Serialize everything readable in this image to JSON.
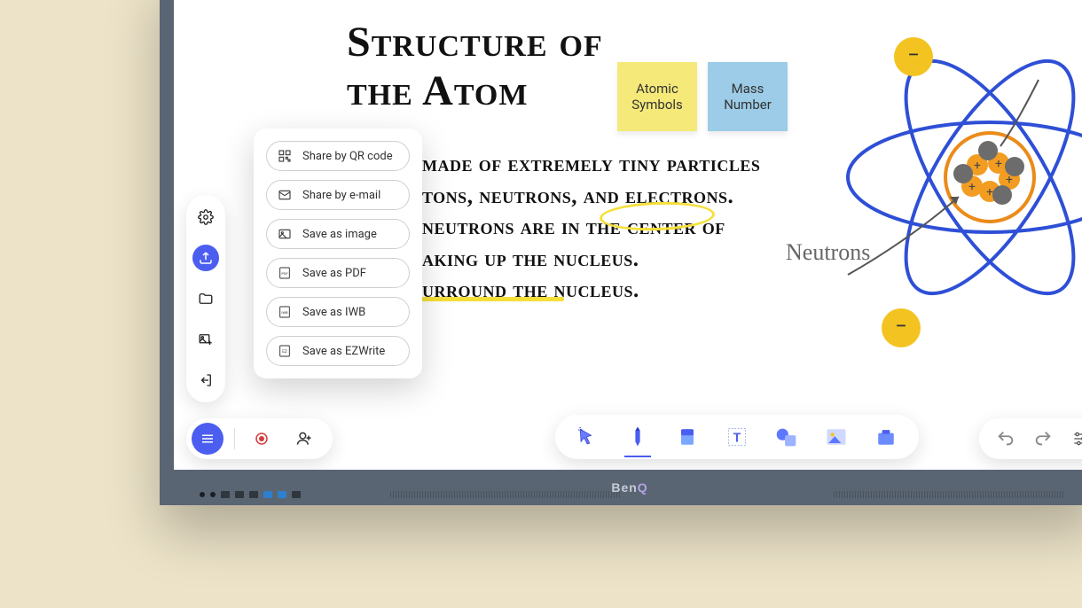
{
  "brand": "BenQ",
  "canvas": {
    "title": "Structure of\nthe Atom",
    "body": "made of extremely tiny particles\ntons, neutrons, and electrons.\n  neutrons are in the center of\naking up the nucleus.\nurround the nucleus.",
    "annotation": "Neutrons",
    "sticky_yellow": "Atomic Symbols",
    "sticky_blue": "Mass Number",
    "electron_symbol": "−",
    "proton_symbol": "+"
  },
  "side_toolbar": {
    "items": [
      {
        "name": "settings",
        "active": false
      },
      {
        "name": "share",
        "active": true
      },
      {
        "name": "folder",
        "active": false
      },
      {
        "name": "add-image",
        "active": false
      },
      {
        "name": "exit",
        "active": false
      }
    ]
  },
  "share_menu": {
    "items": [
      {
        "icon": "qr",
        "label": "Share by QR code"
      },
      {
        "icon": "mail",
        "label": "Share by e-mail"
      },
      {
        "icon": "image",
        "label": "Save as image"
      },
      {
        "icon": "pdf",
        "label": "Save as PDF"
      },
      {
        "icon": "iwb",
        "label": "Save as IWB"
      },
      {
        "icon": "ez",
        "label": "Save as EZWrite"
      }
    ]
  },
  "bottom_left": {
    "menu": "menu",
    "record": "record",
    "add_user": "add-user"
  },
  "bottom_center": {
    "tools": [
      {
        "name": "select"
      },
      {
        "name": "pen",
        "active": true
      },
      {
        "name": "eraser"
      },
      {
        "name": "text"
      },
      {
        "name": "shapes"
      },
      {
        "name": "image"
      },
      {
        "name": "document"
      }
    ]
  },
  "bottom_right": {
    "undo": "undo",
    "redo": "redo",
    "settings": "settings"
  }
}
